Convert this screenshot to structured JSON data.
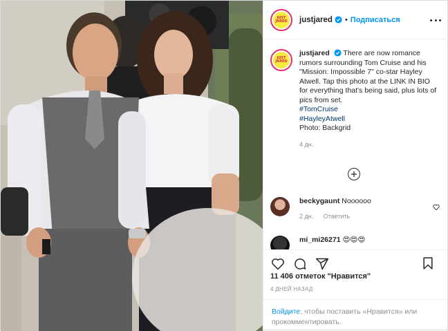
{
  "post": {
    "account": {
      "username": "justjared",
      "follow_label": "Подписаться",
      "logo_text_1": "JUST",
      "logo_text_2": "JARED",
      "verified_icon": "verified-badge-icon"
    },
    "caption": {
      "username": "justjared",
      "text": "There are now romance rumors surrounding Tom Cruise and his \"Mission: Impossible 7\" co-star Hayley Atwell. Tap this photo at the LINK IN BIO for everything that's being said, plus lots of pics from set.",
      "hashtags": [
        "#TomCruise",
        "#HayleyAtwell"
      ],
      "credit": "Photo: Backgrid",
      "time_ago": "4 дн."
    },
    "comments": [
      {
        "username": "beckygaunt",
        "text": "Noooooo",
        "time_ago": "2 дн.",
        "reply_label": "Ответить"
      },
      {
        "username": "mi_mi26271",
        "text": "😍😍😍"
      }
    ],
    "likes_text": "11 406 отметок \"Нравится\"",
    "date_text": "4 ДНЕЙ НАЗАД",
    "login_prompt": {
      "link": "Войдите",
      "rest": ", чтобы поставить «Нравится» или прокомментировать."
    },
    "colors": {
      "accent": "#0095f6",
      "hashtag": "#00376b",
      "muted": "#8e8e8e",
      "logo_yellow": "#f7ec3b",
      "logo_red": "#e0214f"
    }
  }
}
